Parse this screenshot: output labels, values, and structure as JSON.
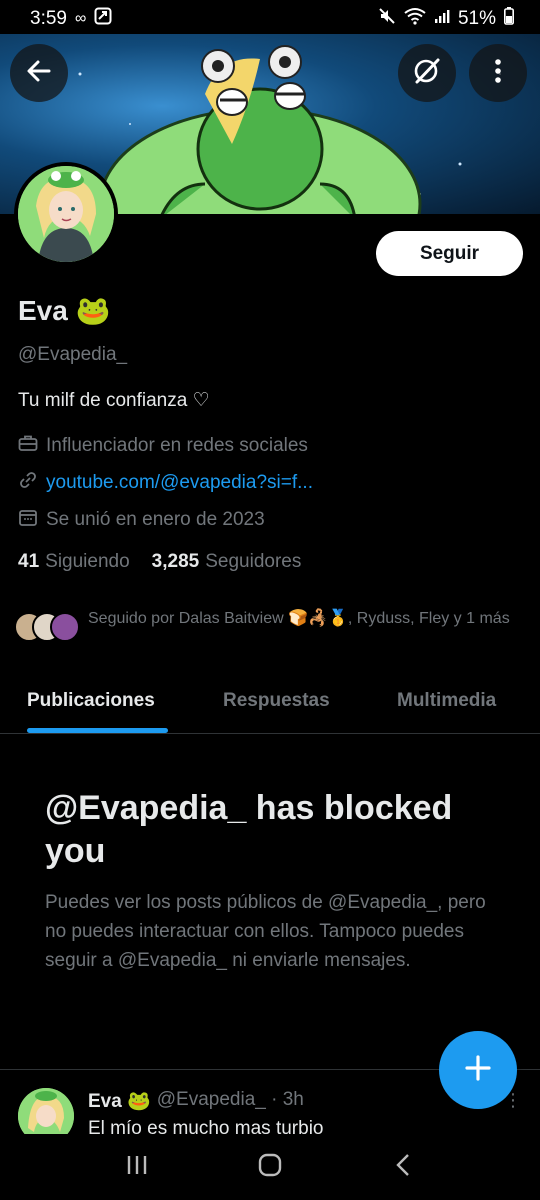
{
  "status_bar": {
    "time": "3:59",
    "battery": "51%"
  },
  "profile": {
    "name": "Eva",
    "name_emoji": "🐸",
    "handle": "@Evapedia_",
    "bio": "Tu milf de confianza ♡",
    "category": "Influenciador en redes sociales",
    "link": "youtube.com/@evapedia?si=f...",
    "joined": "Se unió en enero de 2023",
    "following_count": "41",
    "following_label": "Siguiendo",
    "followers_count": "3,285",
    "followers_label": "Seguidores",
    "followed_by": "Seguido por Dalas Baitview 🍞🦂🥇, Ryduss, Fley y 1 más",
    "follow_button": "Seguir"
  },
  "tabs": [
    {
      "label": "Publicaciones",
      "active": true
    },
    {
      "label": "Respuestas",
      "active": false
    },
    {
      "label": "Multimedia",
      "active": false
    }
  ],
  "blocked": {
    "title": "@Evapedia_ has blocked you",
    "description": "Puedes ver los posts públicos de @Evapedia_, pero no puedes interactuar con ellos. Tampoco puedes seguir a @Evapedia_ ni enviarle mensajes."
  },
  "post": {
    "name": "Eva 🐸",
    "handle_time": "@Evapedia_ · 3h",
    "text": "El mío es mucho mas turbio"
  },
  "icons": {
    "back": "arrow-left-icon",
    "grok": "grok-icon",
    "more": "more-vertical-icon",
    "compose": "plus-icon"
  },
  "colors": {
    "accent": "#1d9bf0",
    "background": "#000000",
    "secondary_text": "#71767b"
  }
}
